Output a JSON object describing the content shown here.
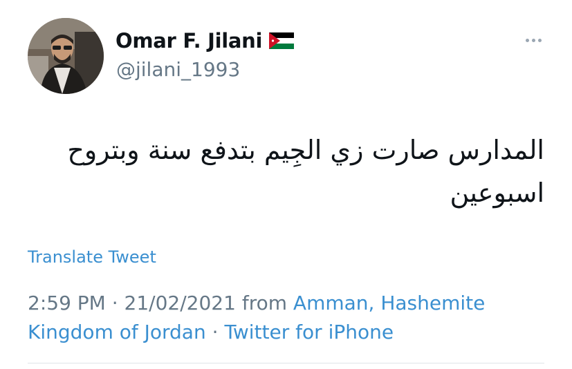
{
  "author": {
    "name": "Omar F. Jilani",
    "handle": "@jilani_1993",
    "avatar_icon": "profile-photo",
    "flag_icon": "jordan-flag"
  },
  "tweet": {
    "text": "المدارس صارت زي الجِيم بتدفع سنة وبتروح اسبوعين",
    "translate_label": "Translate Tweet"
  },
  "meta": {
    "time": "2:59 PM",
    "date": "21/02/2021",
    "from_label": "from",
    "location": "Amman, Hashemite Kingdom of Jordan",
    "separator": "·",
    "client": "Twitter for iPhone"
  },
  "colors": {
    "link": "#3a8fd0",
    "secondary_text": "#657786",
    "primary_text": "#0f1419"
  }
}
